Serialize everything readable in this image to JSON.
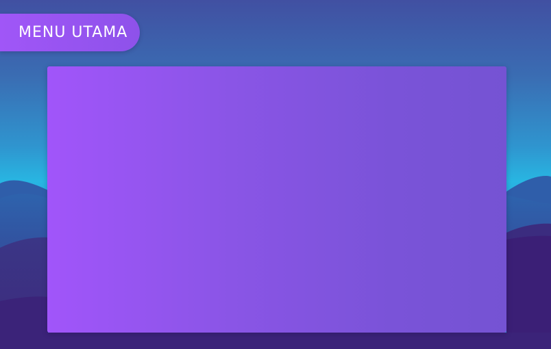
{
  "menu": {
    "label": "MENU UTAMA"
  },
  "panel": {
    "content": ""
  },
  "colors": {
    "sky_top": "#4150a2",
    "sky_mid": "#28b6e2",
    "hill_dark": "#3b2379",
    "hill_mid": "#3c2f80",
    "hill_light": "#2e5ea8",
    "menu_pill": "#a056f7",
    "panel_left": "#a155fa",
    "panel_right": "#7553d3"
  }
}
